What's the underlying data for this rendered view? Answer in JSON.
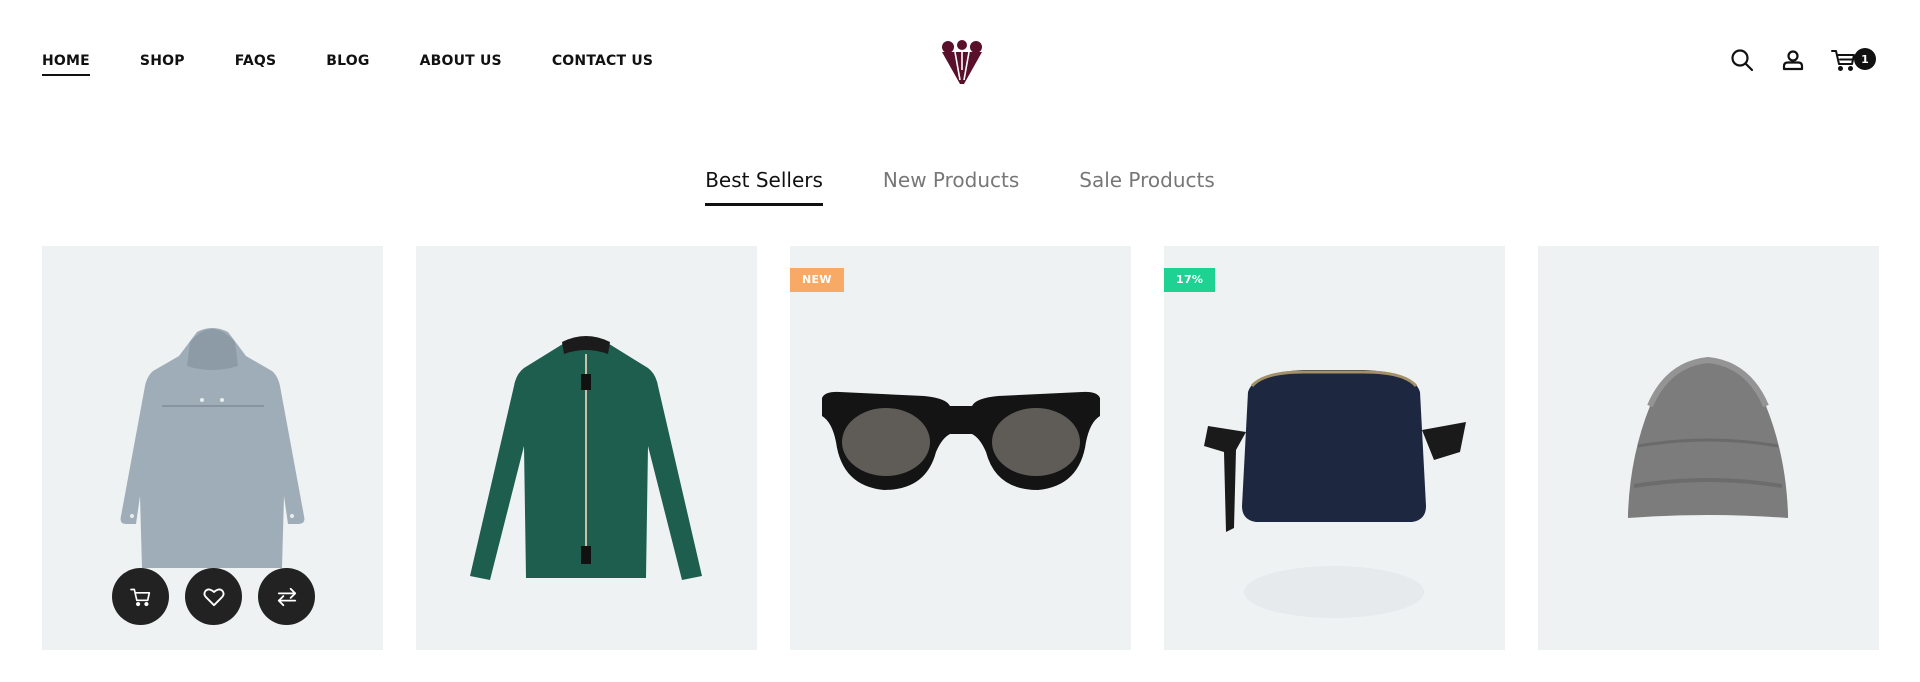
{
  "nav": {
    "items": [
      {
        "label": "HOME",
        "active": true
      },
      {
        "label": "SHOP",
        "active": false
      },
      {
        "label": "FAQS",
        "active": false
      },
      {
        "label": "BLOG",
        "active": false
      },
      {
        "label": "ABOUT US",
        "active": false
      },
      {
        "label": "CONTACT US",
        "active": false
      }
    ]
  },
  "header": {
    "logo_icon": "brand-logo-icon",
    "icons": [
      "search-icon",
      "user-icon",
      "cart-icon"
    ],
    "cart_count": "1"
  },
  "tabs": [
    {
      "label": "Best Sellers",
      "active": true
    },
    {
      "label": "New Products",
      "active": false
    },
    {
      "label": "Sale Products",
      "active": false
    }
  ],
  "products": [
    {
      "image": "raincoat",
      "badge": "",
      "actions": [
        "add-to-cart-icon",
        "heart-icon",
        "compare-icon"
      ]
    },
    {
      "image": "green-jacket",
      "badge": ""
    },
    {
      "image": "sunglasses",
      "badge": "NEW",
      "badge_color": "#f7a965"
    },
    {
      "image": "toiletry-bag",
      "badge": "17%",
      "badge_color": "#1ed392"
    },
    {
      "image": "beanie",
      "badge": ""
    }
  ],
  "colors": {
    "brand": "#5a0f2a",
    "card_bg": "#eff2f3",
    "action_bg": "#222222"
  }
}
